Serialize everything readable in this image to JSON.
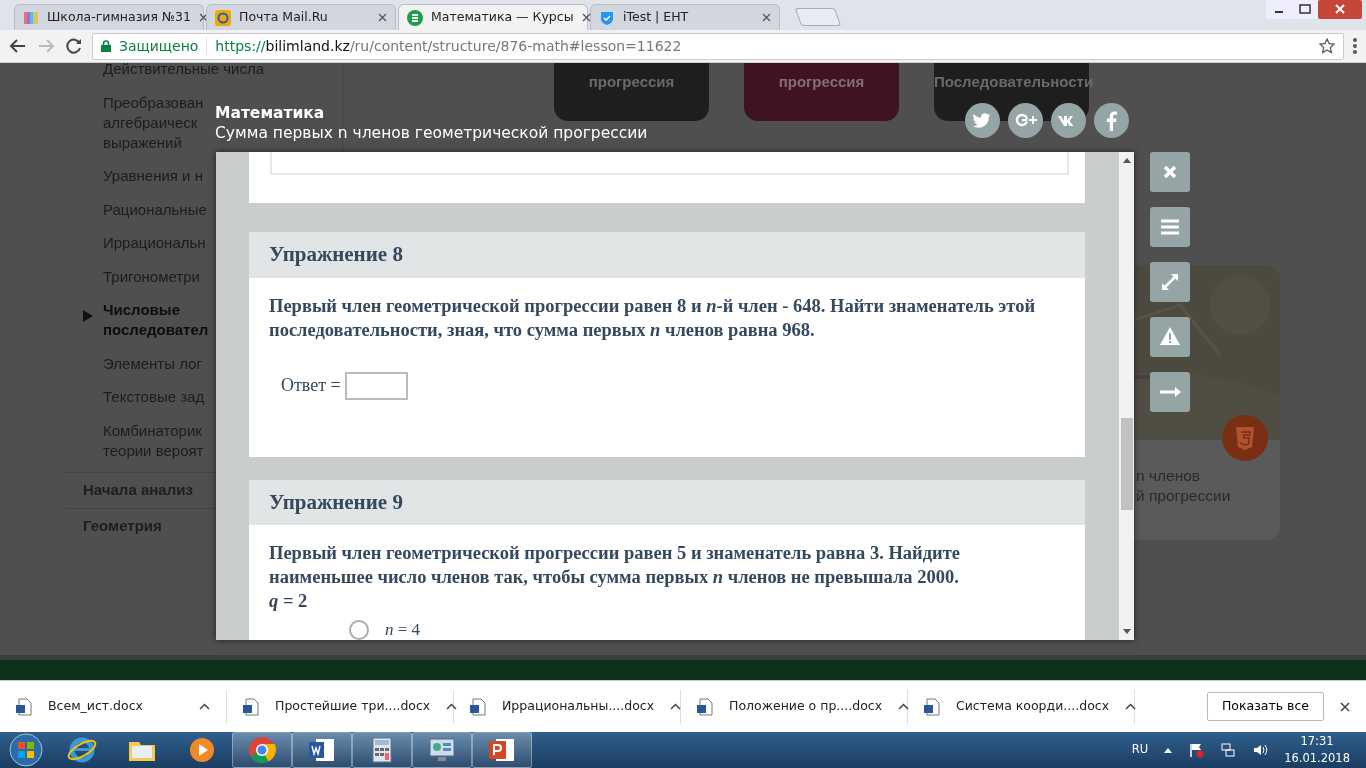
{
  "browser": {
    "tabs": [
      {
        "title": "Школа-гимназия №31",
        "selected": false
      },
      {
        "title": "Почта Mail.Ru",
        "selected": false
      },
      {
        "title": "Математика — Курсы",
        "selected": true
      },
      {
        "title": "iTest | ЕНТ",
        "selected": false
      }
    ],
    "security": "Защищено",
    "url": {
      "scheme": "https://",
      "host": "bilimland.kz",
      "path": "/ru/content/structure/876-math#lesson=11622"
    }
  },
  "sidebar": {
    "items": [
      {
        "lines": [
          "Действительные числа"
        ],
        "selected": false
      },
      {
        "lines": [
          "Преобразован",
          "алгебраическ",
          "выражений"
        ],
        "selected": false
      },
      {
        "lines": [
          "Уравнения и н"
        ],
        "selected": false
      },
      {
        "lines": [
          "Рациональные"
        ],
        "selected": false
      },
      {
        "lines": [
          "Иррациональн"
        ],
        "selected": false
      },
      {
        "lines": [
          "Тригонометри"
        ],
        "selected": false
      },
      {
        "lines": [
          "Числовые",
          "последовател"
        ],
        "selected": true
      },
      {
        "lines": [
          "Элементы лог"
        ],
        "selected": false
      },
      {
        "lines": [
          "Текстовые зад"
        ],
        "selected": false
      },
      {
        "lines": [
          "Комбинаторик",
          "теории вероят"
        ],
        "selected": false
      }
    ],
    "sections": [
      "Начала анализ",
      "Геометрия"
    ]
  },
  "topics": [
    {
      "label": "прогрессия",
      "selected": false
    },
    {
      "label": "прогрессия",
      "selected": true
    },
    {
      "label": "Последовательности",
      "selected": false
    }
  ],
  "preview": {
    "title_lines": [
      "n членов",
      "й прогрессии"
    ]
  },
  "lesson": {
    "subject": "Математика",
    "title": "Сумма первых n членов геометрической прогрессии"
  },
  "exercises": [
    {
      "heading": "Упражнение 8",
      "question": "Первый член геометрической прогрессии равен 8 и *n*-й член - 648. Найти знаменатель этой последовательности, зная, что сумма первых *n* членов равна 968.",
      "kind": "input",
      "answer_label": "Ответ ="
    },
    {
      "heading": "Упражнение 9",
      "question": "Первый член геометрической прогрессии равен 5 и знаменатель равна 3. Найдите наименьшее число членов так, чтобы сумма первых *n* членов не превышала 2000.",
      "note": "*q* = 2",
      "kind": "choice",
      "options": [
        {
          "label": "*n* = 4",
          "selected": false
        }
      ]
    }
  ],
  "downloads": {
    "items": [
      "Всем_ист.docx",
      "Простейшие три....docx",
      "Иррациональны....docx",
      "Положение о пр....docx",
      "Система коорди....docx"
    ],
    "show_all": "Показать все"
  },
  "taskbar": {
    "apps": [
      {
        "kind": "ie",
        "running": false
      },
      {
        "kind": "folder",
        "running": false
      },
      {
        "kind": "player",
        "running": false
      },
      {
        "kind": "chrome",
        "running": true
      },
      {
        "kind": "word",
        "running": true
      },
      {
        "kind": "calculator",
        "running": true
      },
      {
        "kind": "panel",
        "running": true
      },
      {
        "kind": "powerpoint",
        "running": true
      }
    ],
    "language": "RU",
    "time": "17:31",
    "date": "16.01.2018"
  }
}
